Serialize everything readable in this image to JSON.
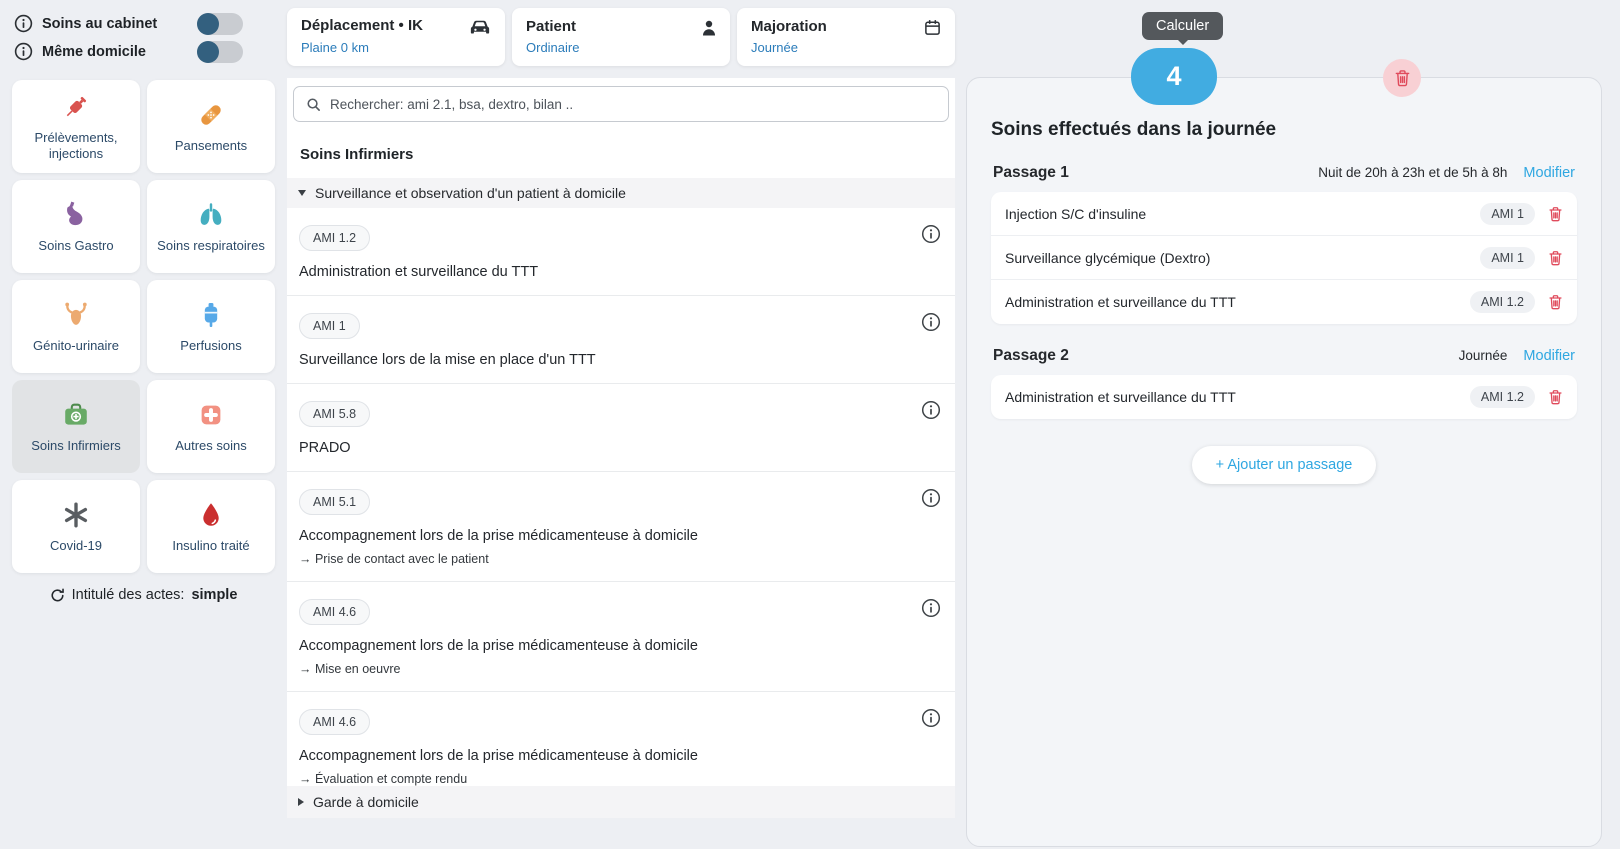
{
  "sidebar": {
    "toggles": [
      {
        "label": "Soins au cabinet",
        "state": "off"
      },
      {
        "label": "Même domicile",
        "state": "off"
      }
    ],
    "categories": [
      {
        "label": "Prélèvements, injections",
        "icon": "syringe-icon",
        "color": "#d9534f",
        "selected": false
      },
      {
        "label": "Pansements",
        "icon": "bandage-icon",
        "color": "#e8963f",
        "selected": false
      },
      {
        "label": "Soins Gastro",
        "icon": "stomach-icon",
        "color": "#8a62a0",
        "selected": false
      },
      {
        "label": "Soins respiratoires",
        "icon": "lungs-icon",
        "color": "#45aec0",
        "selected": false
      },
      {
        "label": "Génito-urinaire",
        "icon": "uterus-icon",
        "color": "#ecaa70",
        "selected": false
      },
      {
        "label": "Perfusions",
        "icon": "iv-bag-icon",
        "color": "#57a9e8",
        "selected": false
      },
      {
        "label": "Soins Infirmiers",
        "icon": "medical-bag-icon",
        "color": "#68aa66",
        "selected": true
      },
      {
        "label": "Autres soins",
        "icon": "plus-square-icon",
        "color": "#f29182",
        "selected": false
      },
      {
        "label": "Covid-19",
        "icon": "virus-icon",
        "color": "#595d61",
        "selected": false
      },
      {
        "label": "Insulino traité",
        "icon": "blood-drop-icon",
        "color": "#ca2f2f",
        "selected": false
      }
    ],
    "footer": {
      "prefix": "Intitulé des actes:",
      "value": "simple"
    }
  },
  "topbar": {
    "cards": [
      {
        "title": "Déplacement • IK",
        "value": "Plaine 0 km",
        "icon": "car-icon"
      },
      {
        "title": "Patient",
        "value": "Ordinaire",
        "icon": "person-icon"
      },
      {
        "title": "Majoration",
        "value": "Journée",
        "icon": "calendar-icon"
      }
    ]
  },
  "catalog": {
    "search_placeholder": "Rechercher: ami 2.1, bsa, dextro, bilan ..",
    "heading": "Soins Infirmiers",
    "sections": [
      {
        "label": "Surveillance et observation d'un patient à domicile",
        "expanded": true
      },
      {
        "label": "Garde à domicile",
        "expanded": false
      }
    ],
    "acts": [
      {
        "code": "AMI 1.2",
        "label": "Administration et surveillance du TTT",
        "sub": ""
      },
      {
        "code": "AMI 1",
        "label": "Surveillance lors de la mise en place d'un TTT",
        "sub": ""
      },
      {
        "code": "AMI 5.8",
        "label": "PRADO",
        "sub": ""
      },
      {
        "code": "AMI 5.1",
        "label": "Accompagnement lors de la prise médicamenteuse à domicile",
        "sub": "→ Prise de contact avec le patient"
      },
      {
        "code": "AMI 4.6",
        "label": "Accompagnement lors de la prise médicamenteuse à domicile",
        "sub": "→ Mise en oeuvre"
      },
      {
        "code": "AMI 4.6",
        "label": "Accompagnement lors de la prise médicamenteuse à domicile",
        "sub": "→ Évaluation et compte rendu"
      }
    ]
  },
  "summary": {
    "calc_tooltip": "Calculer",
    "count": "4",
    "title": "Soins effectués dans la journée",
    "passages": [
      {
        "name": "Passage 1",
        "schedule": "Nuit de 20h à 23h et de 5h à 8h",
        "edit_label": "Modifier",
        "items": [
          {
            "label": "Injection S/C d'insuline",
            "code": "AMI 1"
          },
          {
            "label": "Surveillance glycémique (Dextro)",
            "code": "AMI 1"
          },
          {
            "label": "Administration et surveillance du TTT",
            "code": "AMI 1.2"
          }
        ]
      },
      {
        "name": "Passage 2",
        "schedule": "Journée",
        "edit_label": "Modifier",
        "items": [
          {
            "label": "Administration et surveillance du TTT",
            "code": "AMI 1.2"
          }
        ]
      }
    ],
    "add_passage_label": "+ Ajouter un passage"
  },
  "colors": {
    "accent_blue": "#2fa7e1",
    "link_blue": "#2b7cba",
    "count_pill_blue": "#41ace1",
    "danger_red": "#e04b5c",
    "danger_bg_pink": "#f8d0d4",
    "toggle_knob": "#33607f",
    "tooltip_bg": "#54585c",
    "selected_category_bg": "#e1e3e5",
    "page_bg": "#edeff3",
    "panel_bg": "#f3f5f8"
  }
}
